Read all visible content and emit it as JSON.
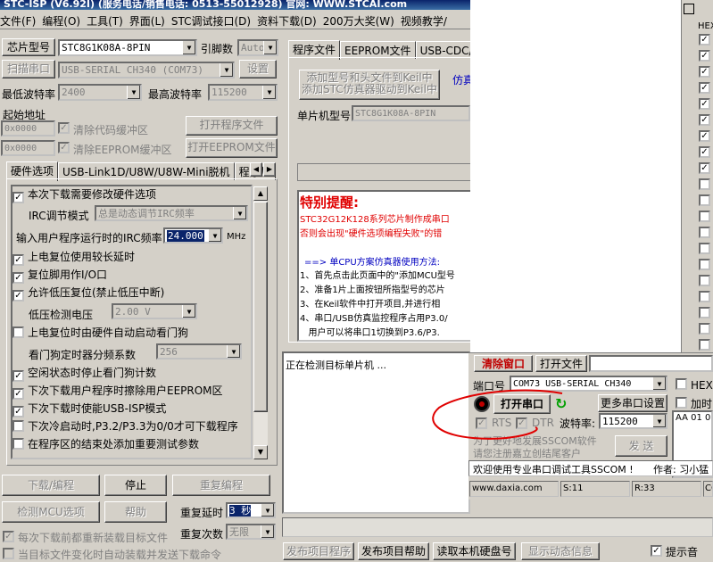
{
  "app": {
    "title": "STC-ISP (V6.92I) (服务电话/销售电话: 0513-55012928) 官网: WWW.STCAI.com"
  },
  "menu": [
    "文件(F)",
    "编程(O)",
    "工具(T)",
    "界面(L)",
    "STC调试接口(D)",
    "资料下载(D)",
    "200万大奖(W)",
    "视频教学/"
  ],
  "left": {
    "chip_label": "芯片型号",
    "chip_value": "STC8G1K08A-8PIN",
    "pin_label": "引脚数",
    "pin_value": "Auto",
    "scan_button": "扫描串口",
    "port_value": "USB-SERIAL CH340 (COM73)",
    "settings_button": "设置",
    "min_baud_label": "最低波特率",
    "min_baud_value": "2400",
    "max_baud_label": "最高波特率",
    "max_baud_value": "115200",
    "start_addr_label": "起始地址",
    "addr1_value": "0x0000",
    "clear_code_label": "清除代码缓冲区",
    "open_program_button": "打开程序文件",
    "addr2_value": "0x0000",
    "clear_eeprom_label": "清除EEPROM缓冲区",
    "open_eeprom_button": "打开EEPROM文件",
    "tabs": [
      "硬件选项",
      "USB-Link1D/U8W/U8W-Mini脱机",
      "程序加"
    ],
    "options": {
      "opt1": "本次下载需要修改硬件选项",
      "irc_mode_label": "IRC调节模式",
      "irc_mode_value": "总是动态调节IRC频率",
      "irc_freq_label": "输入用户程序运行时的IRC频率",
      "irc_freq_value": "24.000",
      "irc_unit": "MHz",
      "opt2": "上电复位使用较长延时",
      "opt3": "复位脚用作I/O口",
      "opt4": "允许低压复位(禁止低压中断)",
      "lvd_label": "低压检测电压",
      "lvd_value": "2.00 V",
      "opt5": "上电复位时由硬件自动启动看门狗",
      "wdt_label": "看门狗定时器分频系数",
      "wdt_value": "256",
      "opt6": "空闲状态时停止看门狗计数",
      "opt7": "下次下载用户程序时擦除用户EEPROM区",
      "opt8": "下次下载时使能USB-ISP模式",
      "opt9": "下次冷启动时,P3.2/P3.3为0/0才可下载程序",
      "opt10": "在程序区的结束处添加重要测试参数"
    },
    "download_button": "下载/编程",
    "stop_button": "停止",
    "reprogram_button": "重复编程",
    "detect_button": "检测MCU选项",
    "help_button": "帮助",
    "repeat_delay_label": "重复延时",
    "repeat_delay_value": "3 秒",
    "reload_label": "每次下载前都重新装载目标文件",
    "repeat_count_label": "重复次数",
    "repeat_count_value": "无限",
    "auto_label": "当目标文件变化时自动装载并发送下载命令"
  },
  "middle": {
    "tabs": [
      "程序文件",
      "EEPROM文件",
      "USB-CDC/串口"
    ],
    "add_keil_button": "添加型号和头文件到Keil中\n添加STC仿真器驱动到Keil中",
    "sim_label": "仿真",
    "mcu_label": "单片机型号",
    "mcu_value": "STC8G1K08A-8PIN",
    "notice_title": "特别提醒:",
    "notice_line1": "STC32G12K128系列芯片制作成串口",
    "notice_line2": "否则会出现\"硬件选项编程失败\"的错",
    "cpu_title": "==> 单CPU方案仿真器使用方法:",
    "step1": "1、首先点击此页面中的\"添加MCU型号",
    "step2": "2、准备1片上面按钮所指型号的芯片",
    "step3": "3、在Keil软件中打开项目,并进行相",
    "step4": "4、串口/USB仿真监控程序占用P3.0/",
    "step5": "   用户可以将串口1切换到P3.6/P3.",
    "status_text": "正在检测目标单片机 ...",
    "bottom_buttons": [
      "发布项目程序",
      "发布项目帮助",
      "读取本机硬盘号",
      "显示动态信息"
    ],
    "prompt_label": "提示音"
  },
  "sscom": {
    "clear_window": "清除窗口",
    "open_file": "打开文件",
    "port_label": "端口号",
    "port_value": "COM73 USB-SERIAL CH340",
    "hex_label": "HEX显",
    "open_port": "打开串口",
    "more_settings": "更多串口设置",
    "add_label": "加时",
    "rts_label": "RTS",
    "dtr_label": "DTR",
    "baud_label": "波特率:",
    "baud_value": "115200",
    "send_data": "AA 01 0",
    "promo_line1": "为了更好地发展SSCOM软件",
    "promo_line2": "请您注册嘉立创结尾客户",
    "send_button": "发 送",
    "welcome": "欢迎使用专业串口调试工具SSCOM !",
    "author": "作者: 习小猛",
    "status_site": "www.daxia.com",
    "status_s": "S:11",
    "status_r": "R:33",
    "status_co": "CO"
  },
  "right_panel": {
    "header": "HEX"
  }
}
